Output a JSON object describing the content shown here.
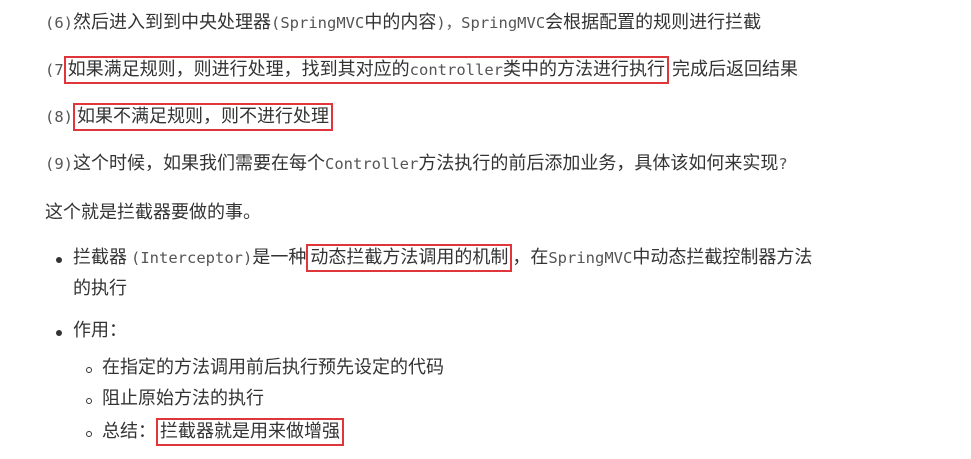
{
  "steps": {
    "s6": {
      "num": "(6)",
      "t1": "然后进入到到中央处理器",
      "m1": "(SpringMVC",
      "t2": "中的内容",
      "m2": ")，SpringMVC",
      "t3": "会根据配置的规则进行拦截"
    },
    "s7": {
      "num": "(7",
      "t1": "如果满足规则，则进行处理，找到其对应的",
      "m1": "controller",
      "t2": "类中的方法进行执行",
      "t3": "完成后返回结果"
    },
    "s8": {
      "num": "(8)",
      "t1": "如果不满足规则，则不进行处理"
    },
    "s9": {
      "num": "(9)",
      "t1": "这个时候，如果我们需要在每个",
      "m1": "Controller",
      "t2": "方法执行的前后添加业务，具体该如何来实现",
      "t3": "?"
    }
  },
  "summary": "这个就是拦截器要做的事。",
  "bullets": {
    "b1": {
      "t1": "拦截器",
      "m1": "(Interceptor)",
      "t2": "是一种",
      "boxed": "动态拦截方法调用的机制",
      "t3": "，在",
      "m2": "SpringMVC",
      "t4": "中动态拦截控制器方法",
      "cont": "的执行"
    },
    "b2": {
      "label": "作用："
    },
    "subs": {
      "s1": "在指定的方法调用前后执行预先设定的代码",
      "s2": "阻止原始方法的执行",
      "s3_label": "总结：",
      "s3_boxed": "拦截器就是用来做增强"
    }
  },
  "colors": {
    "highlight_border": "#e0353a",
    "text": "#333333"
  }
}
